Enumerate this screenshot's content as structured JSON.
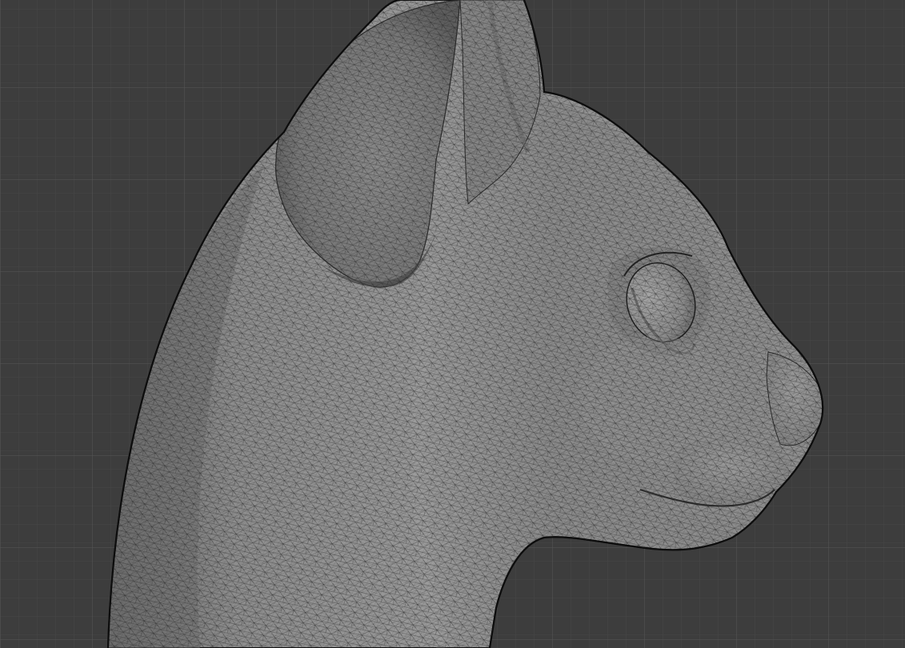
{
  "viewport": {
    "label": "",
    "background_color": "#3d3d3d",
    "grid_minor_color": "#474747",
    "grid_major_color": "#525252",
    "object": {
      "subject": "cat-head-sculpt",
      "display": "wireframe-on-shaded",
      "surface_color": "#8f8f8f",
      "wire_color": "#1e1e1e"
    }
  }
}
